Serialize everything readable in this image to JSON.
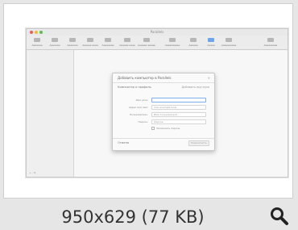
{
  "preview": {
    "caption": "950x629 (77 KB)",
    "zoom_icon": "magnifier-icon"
  },
  "screenshot": {
    "window_title": "Parallels",
    "toolbar": [
      {
        "label": "Aaaaaaa"
      },
      {
        "label": "Aaaaaaa"
      },
      {
        "label": "Aaaaaaa"
      },
      {
        "label": "Aaaaaa aaaa"
      },
      {
        "label": "Aaaaaaaa"
      },
      {
        "label": "Aaaaaa aaaa"
      },
      {
        "label": "Aaaaaa aaaaaaa"
      },
      {
        "label": "Aaaaaaaaaa"
      },
      {
        "label": "Aaaaaa"
      },
      {
        "label": "Aaaaa"
      },
      {
        "label": "Aaaaaaaaaa"
      },
      {
        "label": "Aaaaaaaaa"
      }
    ],
    "sidebar_footer": "+  –  ⚙",
    "dialog": {
      "title": "Добавить компьютер в Parallels",
      "close": "×",
      "section_left": "Компьютер и профиль",
      "section_right": "Добавить вручную",
      "rows": [
        {
          "label": "Имя узла:",
          "value": ""
        },
        {
          "label": "Адрес или имя:",
          "value": "mac.example.local"
        },
        {
          "label": "Пользователь:",
          "value": "Имя пользователя"
        },
        {
          "label": "Пароль:",
          "value": "Пароль"
        }
      ],
      "checkbox_label": "Запомнить пароль",
      "footer_left": "Отмена",
      "button": "Подключить"
    }
  }
}
